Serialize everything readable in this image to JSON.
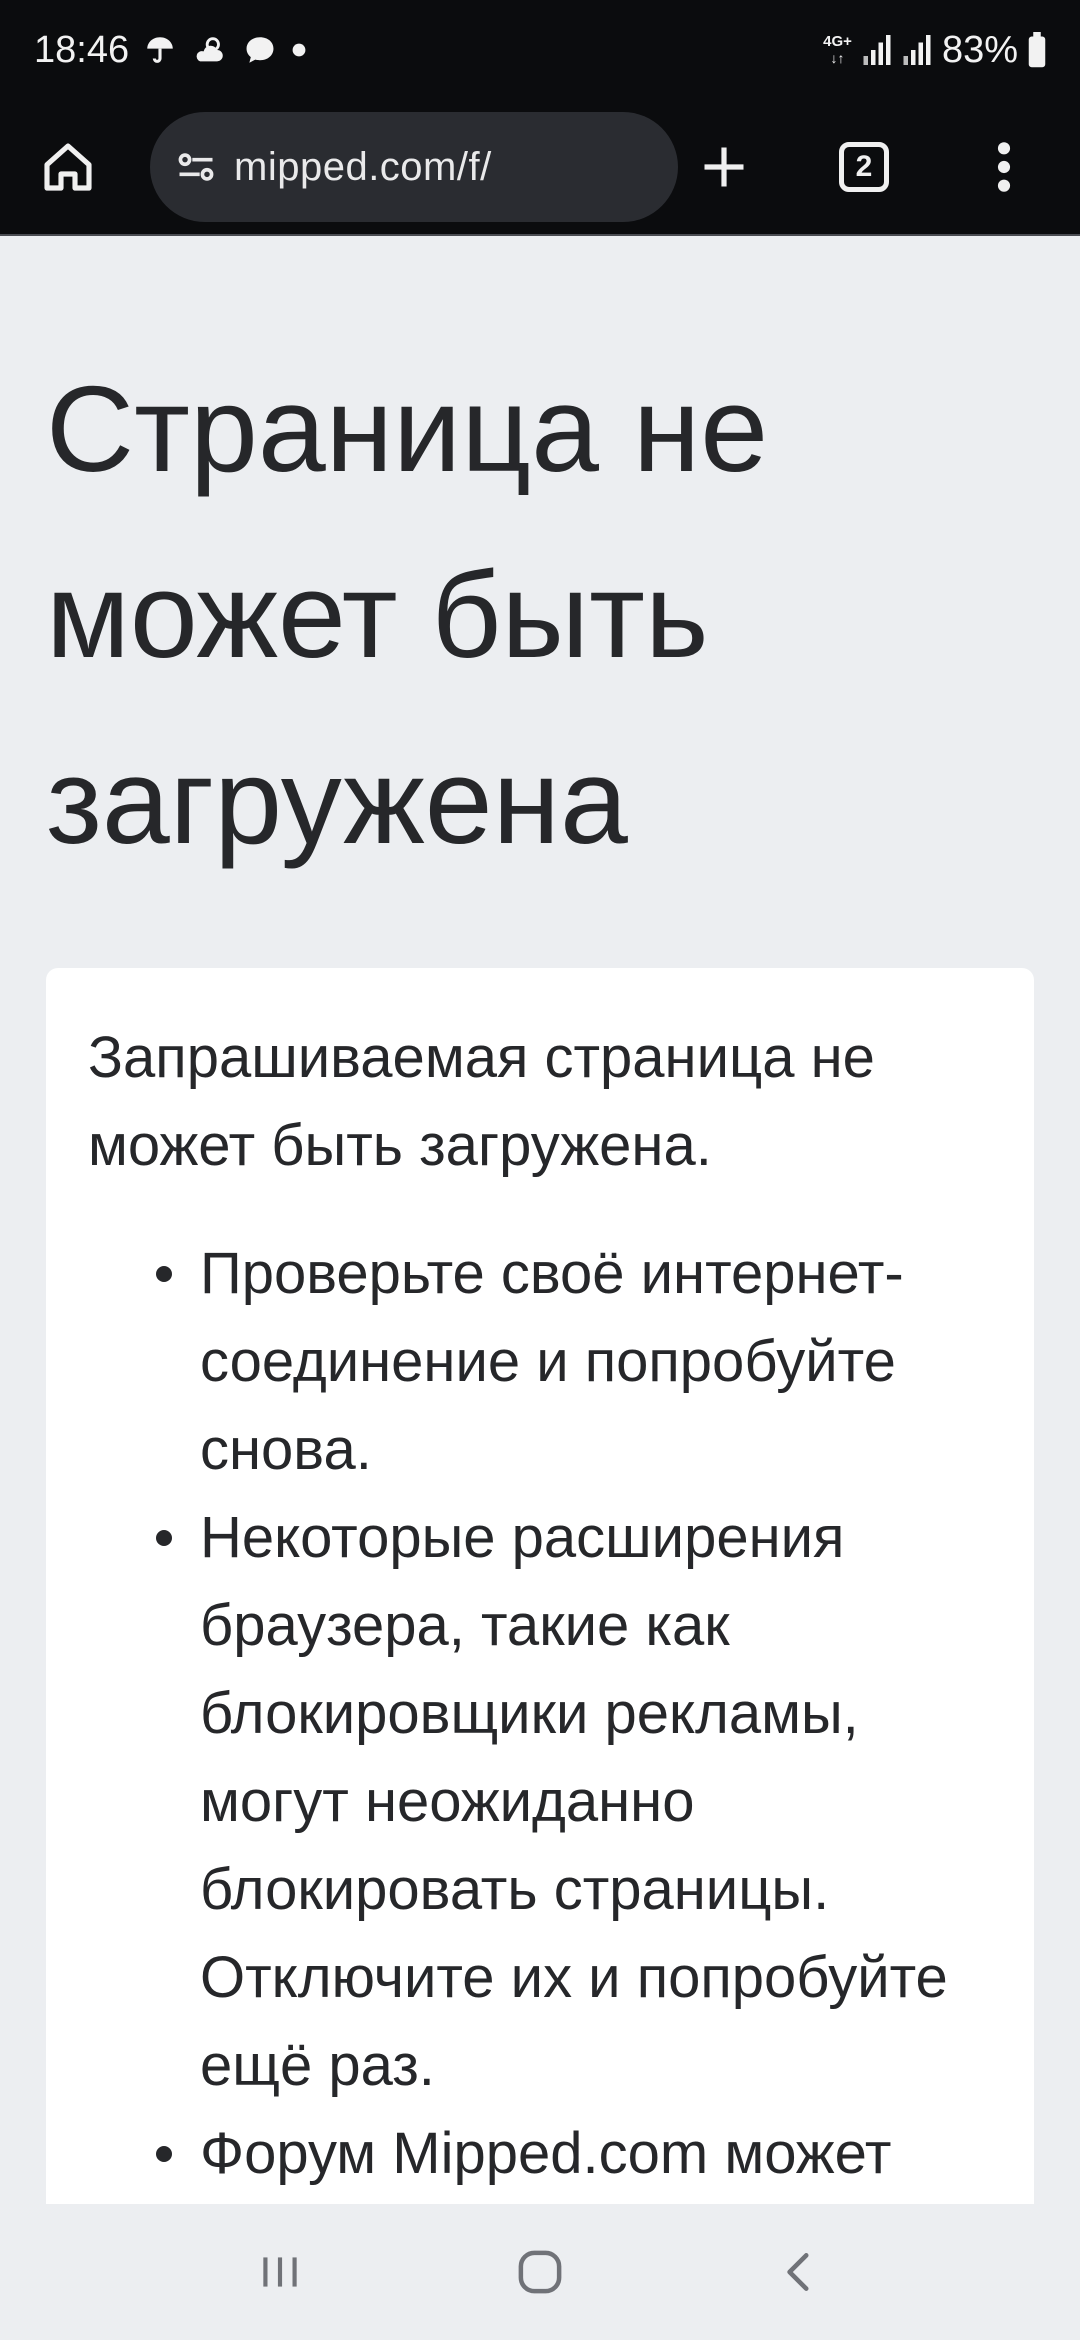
{
  "status_bar": {
    "time": "18:46",
    "network": "4G+",
    "battery": "83%",
    "left_icons": [
      "umbrella-icon",
      "weather-icon",
      "chat-icon",
      "dot-icon"
    ],
    "right_icons": [
      "network-type-icon",
      "signal-icon",
      "signal-icon",
      "battery-icon"
    ]
  },
  "toolbar": {
    "url": "mipped.com/f/",
    "tab_count": "2"
  },
  "page": {
    "title": "Страница не может быть загружена",
    "lead": "Запрашиваемая страница не может быть загружена.",
    "items": [
      "Проверьте своё интернет-соединение и попробуйте снова.",
      "Некоторые расширения браузера, такие как блокировщики рекламы, могут неожиданно блокировать страницы. Отключите их и попробуйте ещё раз.",
      "Форум Mipped.com может"
    ]
  },
  "colors": {
    "chrome_dark": "#0b0c0e",
    "url_pill": "#2a2c31",
    "page_bg": "#eceef1",
    "card_bg": "#ffffff",
    "text": "#26272a"
  }
}
